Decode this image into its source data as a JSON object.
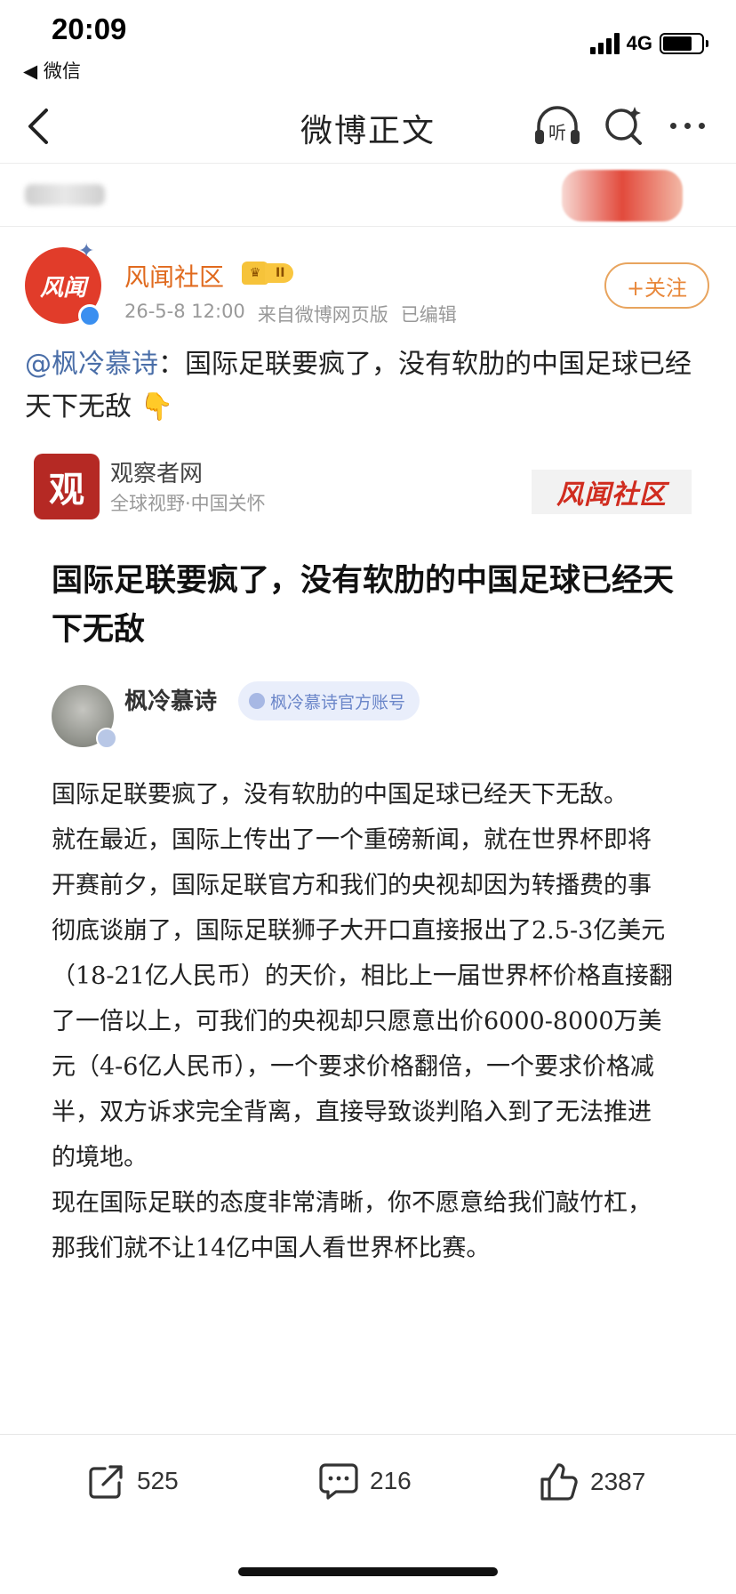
{
  "status_bar": {
    "time": "20:09",
    "back_app": "◀ 微信",
    "network": "4G",
    "battery_level": 0.75
  },
  "nav": {
    "title": "微博正文",
    "listen_label": "听"
  },
  "author": {
    "name": "风闻社区",
    "avatar_text": "风闻",
    "level": "II",
    "date": "26-5-8 12:00",
    "source": "来自微博网页版",
    "edited": "已编辑",
    "follow_label": "+关注"
  },
  "post": {
    "mention": "@枫冷慕诗",
    "text": "：国际足联要疯了，没有软肋的中国足球已经天下无敌 👇"
  },
  "article": {
    "source_logo": "观",
    "source_name": "观察者网",
    "source_slogan": "全球视野·中国关怀",
    "watermark": "风闻社区",
    "title": "国际足联要疯了，没有软肋的中国足球已经天下无敌",
    "author": "枫冷慕诗",
    "author_tag": "枫冷慕诗官方账号",
    "paragraphs": [
      "国际足联要疯了，没有软肋的中国足球已经天下无敌。",
      "就在最近，国际上传出了一个重磅新闻，就在世界杯即将开赛前夕，国际足联官方和我们的央视却因为转播费的事彻底谈崩了，国际足联狮子大开口直接报出了2.5-3亿美元（18-21亿人民币）的天价，相比上一届世界杯价格直接翻了一倍以上，可我们的央视却只愿意出价6000-8000万美元（4-6亿人民币），一个要求价格翻倍，一个要求价格减半，双方诉求完全背离，直接导致谈判陷入到了无法推进的境地。",
      "现在国际足联的态度非常清晰，你不愿意给我们敲竹杠，那我们就不让14亿中国人看世界杯比赛。"
    ]
  },
  "toolbar": {
    "share_count": "525",
    "comment_count": "216",
    "like_count": "2387"
  },
  "colors": {
    "brand_orange": "#e06a1e",
    "mention_blue": "#4a6ea8",
    "guancha_red": "#b52924"
  }
}
